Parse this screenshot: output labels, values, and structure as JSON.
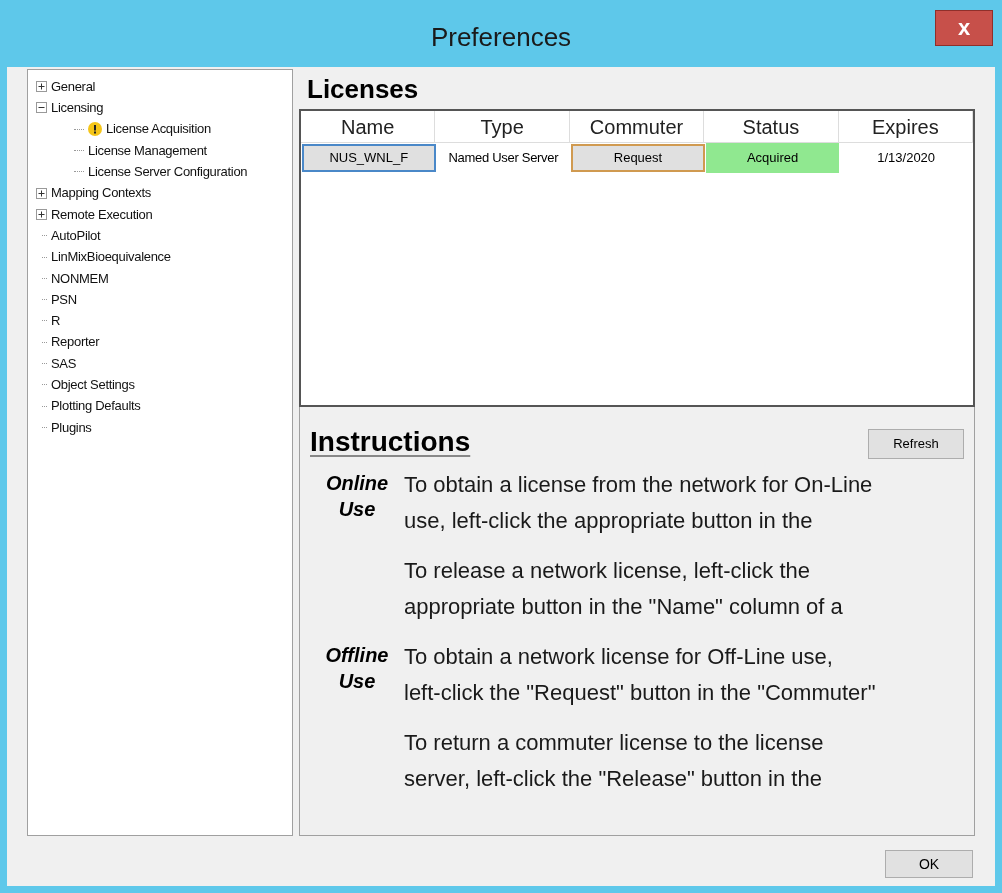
{
  "window": {
    "title": "Preferences",
    "close": "x"
  },
  "tree": [
    {
      "label": "General",
      "kind": "group",
      "expanded": false
    },
    {
      "label": "Licensing",
      "kind": "group",
      "expanded": true,
      "children": [
        {
          "label": "License Acquisition",
          "warning": true
        },
        {
          "label": "License Management",
          "warning": false
        },
        {
          "label": "License Server Configuration",
          "warning": false
        }
      ]
    },
    {
      "label": "Mapping Contexts",
      "kind": "group",
      "expanded": false
    },
    {
      "label": "Remote Execution",
      "kind": "group",
      "expanded": false
    },
    {
      "label": "AutoPilot",
      "kind": "leaf"
    },
    {
      "label": "LinMixBioequivalence",
      "kind": "leaf"
    },
    {
      "label": "NONMEM",
      "kind": "leaf"
    },
    {
      "label": "PSN",
      "kind": "leaf"
    },
    {
      "label": "R",
      "kind": "leaf"
    },
    {
      "label": "Reporter",
      "kind": "leaf"
    },
    {
      "label": "SAS",
      "kind": "leaf"
    },
    {
      "label": "Object Settings",
      "kind": "leaf"
    },
    {
      "label": "Plotting Defaults",
      "kind": "leaf"
    },
    {
      "label": "Plugins",
      "kind": "leaf"
    }
  ],
  "licenses": {
    "heading": "Licenses",
    "columns": [
      "Name",
      "Type",
      "Commuter",
      "Status",
      "Expires"
    ],
    "rows": [
      {
        "name": "NUS_WNL_F",
        "type": "Named User Server",
        "commuter": "Request",
        "status": "Acquired",
        "expires": "1/13/2020"
      }
    ]
  },
  "instructions": {
    "heading": "Instructions",
    "refresh": "Refresh",
    "sections": [
      {
        "label": [
          "Online",
          "Use"
        ],
        "paragraphs": [
          [
            "To obtain a license from the network for On-Line",
            "use, left-click the appropriate button in the"
          ],
          [
            "To release a network license, left-click the",
            "appropriate button in the \"Name\" column of a"
          ]
        ]
      },
      {
        "label": [
          "Offline",
          "Use"
        ],
        "paragraphs": [
          [
            "To obtain a network license for Off-Line use,",
            "left-click the \"Request\" button in the \"Commuter\""
          ],
          [
            "To return a commuter license to the license",
            "server, left-click the \"Release\" button in the"
          ]
        ]
      }
    ]
  },
  "ok": "OK"
}
